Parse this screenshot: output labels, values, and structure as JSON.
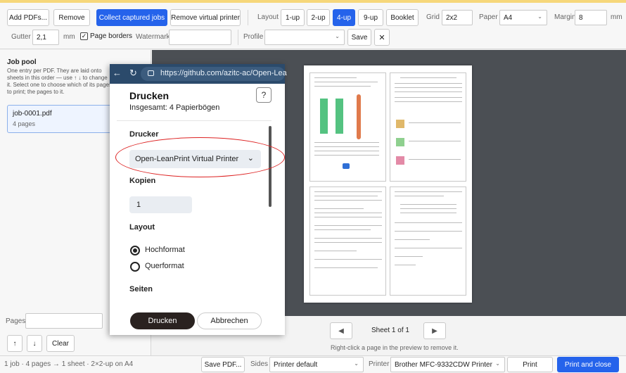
{
  "toolbar": {
    "add_pdfs": "Add PDFs...",
    "remove": "Remove",
    "collect_jobs": "Collect captured jobs",
    "remove_virtual_printer": "Remove virtual printer",
    "layout_label": "Layout",
    "layouts": [
      "1-up",
      "2-up",
      "4-up",
      "9-up",
      "Booklet"
    ],
    "active_layout": "4-up",
    "grid_label": "Grid",
    "grid_value": "2x2",
    "paper_label": "Paper",
    "paper_value": "A4",
    "margin_label": "Margin",
    "margin_value": "8",
    "margin_unit": "mm",
    "gutter_label": "Gutter",
    "gutter_value": "2,1",
    "gutter_unit": "mm",
    "page_borders_label": "Page borders",
    "page_borders_checked": true,
    "watermark_label": "Watermark",
    "watermark_value": "",
    "profile_label": "Profile",
    "profile_value": "",
    "save": "Save",
    "close_glyph": "✕"
  },
  "sidebar": {
    "title": "Job pool",
    "description": "One entry per PDF. They are laid onto sheets in this order — use ↑ ↓ to change it. Select one to choose which of its pages to print; the pages to it.",
    "jobs": [
      {
        "name": "job-0001.pdf",
        "pages": "4 pages"
      }
    ],
    "pages_label": "Pages",
    "pages_value": "",
    "up_glyph": "↑",
    "down_glyph": "↓",
    "clear": "Clear"
  },
  "pager": {
    "prev_glyph": "◀",
    "next_glyph": "▶",
    "sheet_text": "Sheet 1 of 1",
    "hint": "Right-click a page in the preview to remove it."
  },
  "status": {
    "summary": "1 job · 4 pages → 1 sheet · 2×2-up on A4",
    "save_pdf": "Save PDF...",
    "sides_label": "Sides",
    "sides_value": "Printer default",
    "printer_label": "Printer",
    "printer_value": "Brother MFC-9332CDW Printer",
    "print": "Print",
    "print_close": "Print and close"
  },
  "dialog": {
    "back_glyph": "←",
    "reload_glyph": "↻",
    "url": "https://github.com/azitc-ac/Open-Lea",
    "url_domain": "github.com",
    "title": "Drucken",
    "help_glyph": "?",
    "subtitle": "Insgesamt: 4 Papierbögen",
    "printer_label": "Drucker",
    "printer_value": "Open-LeanPrint Virtual Printer",
    "copies_label": "Kopien",
    "copies_value": "1",
    "layout_label": "Layout",
    "portrait": "Hochformat",
    "landscape": "Querformat",
    "pages_label": "Seiten",
    "print_button": "Drucken",
    "cancel_button": "Abbrechen"
  },
  "colors": {
    "accent": "#2563eb",
    "highlight_ring": "#dd2222",
    "preview_bg": "#4b4f54"
  }
}
